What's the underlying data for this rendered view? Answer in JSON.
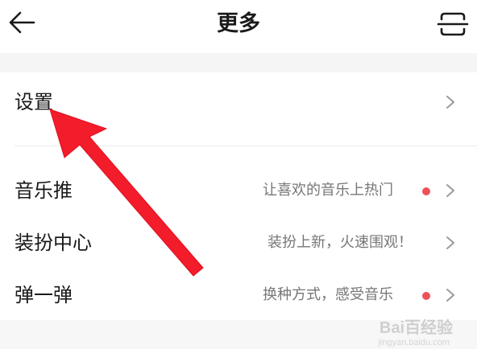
{
  "header": {
    "title": "更多",
    "back_icon": "arrow-left-icon",
    "scan_icon": "scan-icon"
  },
  "settings_row": {
    "label": "设置"
  },
  "menu_rows": [
    {
      "label": "音乐推",
      "subtitle": "让喜欢的音乐上热门",
      "has_dot": true
    },
    {
      "label": "装扮中心",
      "subtitle": "装扮上新，火速围观！",
      "has_dot": false
    },
    {
      "label": "弹一弹",
      "subtitle": "换种方式，感受音乐",
      "has_dot": true
    }
  ],
  "colors": {
    "badge_dot": "#f0505a",
    "annotation_arrow": "#f21c2a"
  },
  "watermark": {
    "text": "Bai百经验",
    "url": "jingyan.baidu.com"
  }
}
